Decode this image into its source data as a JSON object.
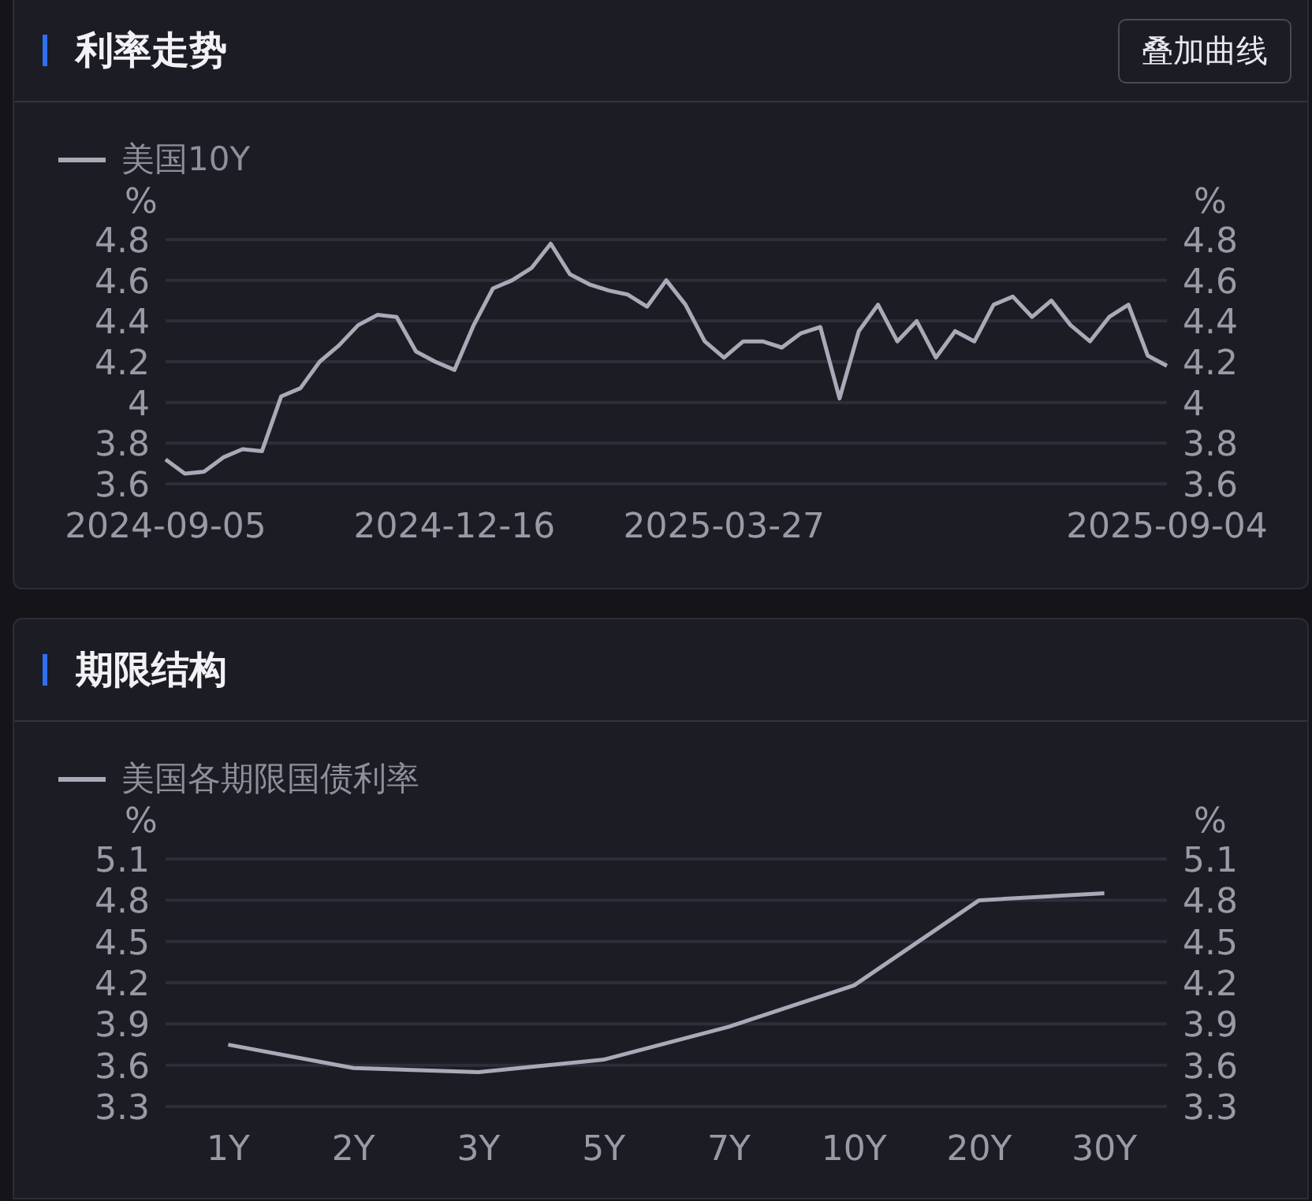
{
  "panels": [
    {
      "title": "利率走势",
      "button": "叠加曲线",
      "chart_data": {
        "type": "line",
        "grid": true,
        "ylabel": "%",
        "y2label": "%",
        "ylim": [
          3.6,
          4.8
        ],
        "y2lim": [
          3.6,
          4.8
        ],
        "yticks": [
          3.6,
          3.8,
          4,
          4.2,
          4.4,
          4.6,
          4.8
        ],
        "y2ticks": [
          3.6,
          3.8,
          4,
          4.2,
          4.4,
          4.6,
          4.8
        ],
        "categories": [
          "2024-09-05",
          null,
          null,
          null,
          null,
          null,
          null,
          null,
          null,
          null,
          null,
          null,
          null,
          null,
          null,
          "2024-12-16",
          null,
          null,
          null,
          null,
          null,
          null,
          null,
          null,
          null,
          null,
          null,
          null,
          null,
          "2025-03-27",
          null,
          null,
          null,
          null,
          null,
          null,
          null,
          null,
          null,
          null,
          null,
          null,
          null,
          null,
          null,
          null,
          null,
          null,
          null,
          null,
          null,
          null,
          "2025-09-04"
        ],
        "series": [
          {
            "name": "美国10Y",
            "color": "#a9a9b8",
            "values": [
              3.72,
              3.65,
              3.66,
              3.73,
              3.77,
              3.76,
              4.03,
              4.07,
              4.2,
              4.28,
              4.38,
              4.43,
              4.42,
              4.25,
              4.2,
              4.16,
              4.38,
              4.56,
              4.6,
              4.66,
              4.78,
              4.63,
              4.58,
              4.55,
              4.53,
              4.47,
              4.6,
              4.48,
              4.3,
              4.22,
              4.3,
              4.3,
              4.27,
              4.34,
              4.37,
              4.02,
              4.35,
              4.48,
              4.3,
              4.4,
              4.22,
              4.35,
              4.3,
              4.48,
              4.52,
              4.42,
              4.5,
              4.38,
              4.3,
              4.42,
              4.48,
              4.23,
              4.18
            ]
          }
        ]
      }
    },
    {
      "title": "期限结构",
      "chart_data": {
        "type": "line",
        "grid": true,
        "ylabel": "%",
        "y2label": "%",
        "categories": [
          "1Y",
          "2Y",
          "3Y",
          "5Y",
          "7Y",
          "10Y",
          "20Y",
          "30Y"
        ],
        "ylim": [
          3.3,
          5.1
        ],
        "y2lim": [
          3.3,
          5.1
        ],
        "yticks": [
          3.3,
          3.6,
          3.9,
          4.2,
          4.5,
          4.8,
          5.1
        ],
        "y2ticks": [
          3.3,
          3.6,
          3.9,
          4.2,
          4.5,
          4.8,
          5.1
        ],
        "series": [
          {
            "name": "美国各期限国债利率",
            "color": "#a9a9b8",
            "values": [
              3.75,
              3.58,
              3.55,
              3.64,
              3.88,
              4.18,
              4.8,
              4.85
            ]
          }
        ]
      }
    }
  ]
}
